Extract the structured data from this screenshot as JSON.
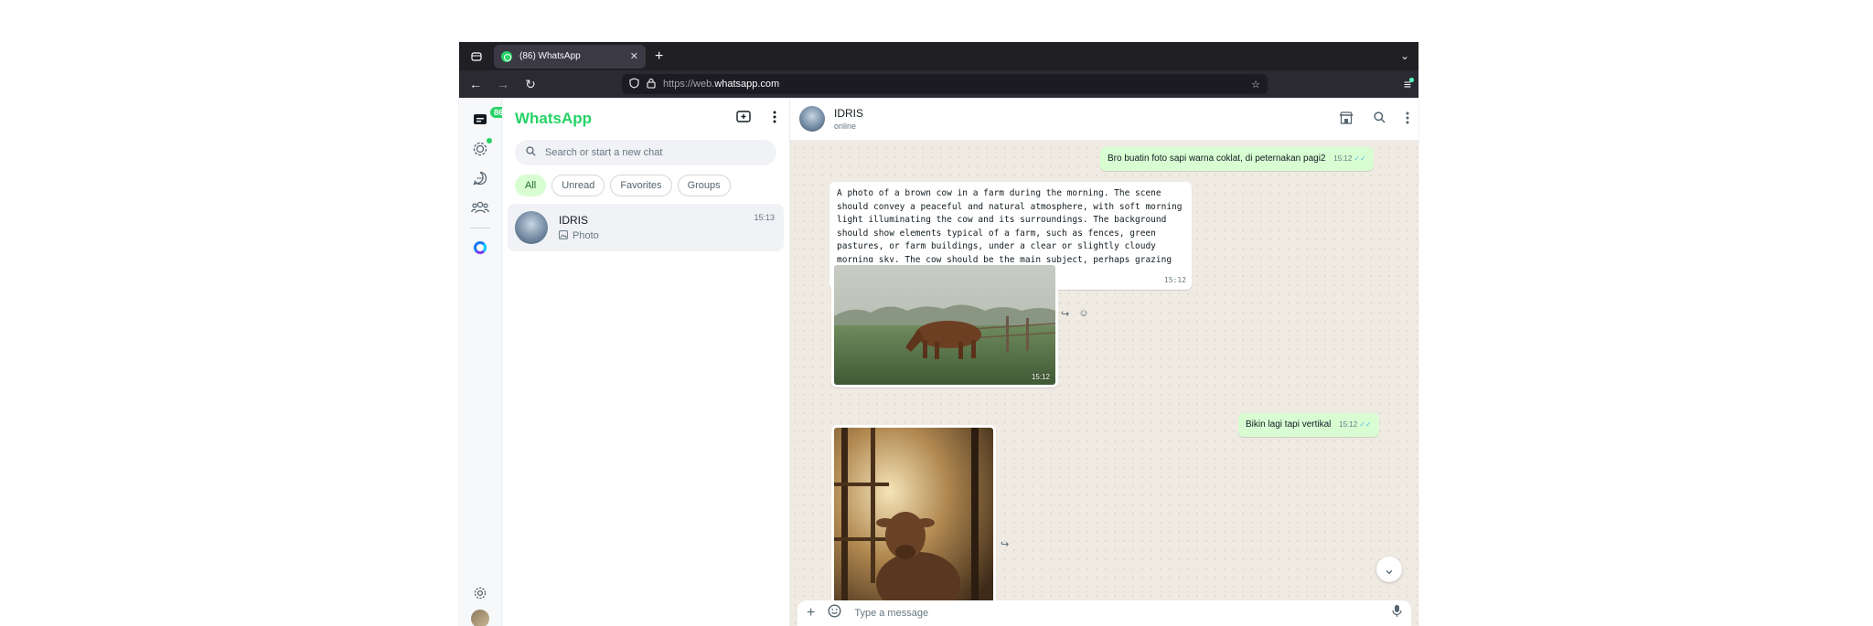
{
  "browser": {
    "tab_title": "(86) WhatsApp",
    "address_proto": "https://web.",
    "address_host": "whatsapp.com",
    "icons": {
      "tab_overview": "tab-overview-icon",
      "tab_close": "close-icon",
      "new_tab": "plus-icon",
      "list_tabs": "chevron-down-icon",
      "back": "back-icon",
      "forward": "forward-icon",
      "reload": "reload-icon",
      "shield": "shield-icon",
      "lock": "lock-icon",
      "bookmark": "star-icon",
      "menu": "hamburger-icon"
    }
  },
  "rail": {
    "chats_badge": "86",
    "icons": [
      "chats-icon",
      "status-icon",
      "channels-icon",
      "communities-icon",
      "meta-ai-icon",
      "settings-icon",
      "profile-avatar"
    ]
  },
  "sidebar": {
    "title": "WhatsApp",
    "search_placeholder": "Search or start a new chat",
    "filters": [
      "All",
      "Unread",
      "Favorites",
      "Groups"
    ],
    "chat": {
      "name": "IDRIS",
      "time": "15:13",
      "last": "Photo"
    }
  },
  "chat": {
    "contact_name": "IDRIS",
    "contact_status": "online",
    "messages": {
      "m1_text": "Bro buatin foto sapi warna coklat, di peternakan pagi2",
      "m1_time": "15:12",
      "m2_text": "A photo of a brown cow in a farm during the morning. The scene should convey a peaceful and natural atmosphere, with soft morning light illuminating the cow and its surroundings. The background should show elements typical of a farm, such as fences, green pastures, or farm buildings, under a clear or slightly cloudy morning sky. The cow should be the main subject, perhaps grazing or standing calmly.",
      "m2_time": "15:12",
      "photo1_time": "15:12",
      "m3_text": "Bikin lagi tapi vertikal",
      "m3_time": "15:12"
    },
    "composer_placeholder": "Type a message"
  },
  "colors": {
    "brand": "#25D366",
    "sent_bubble": "#d9fdd3",
    "chat_background": "#efeae2"
  }
}
